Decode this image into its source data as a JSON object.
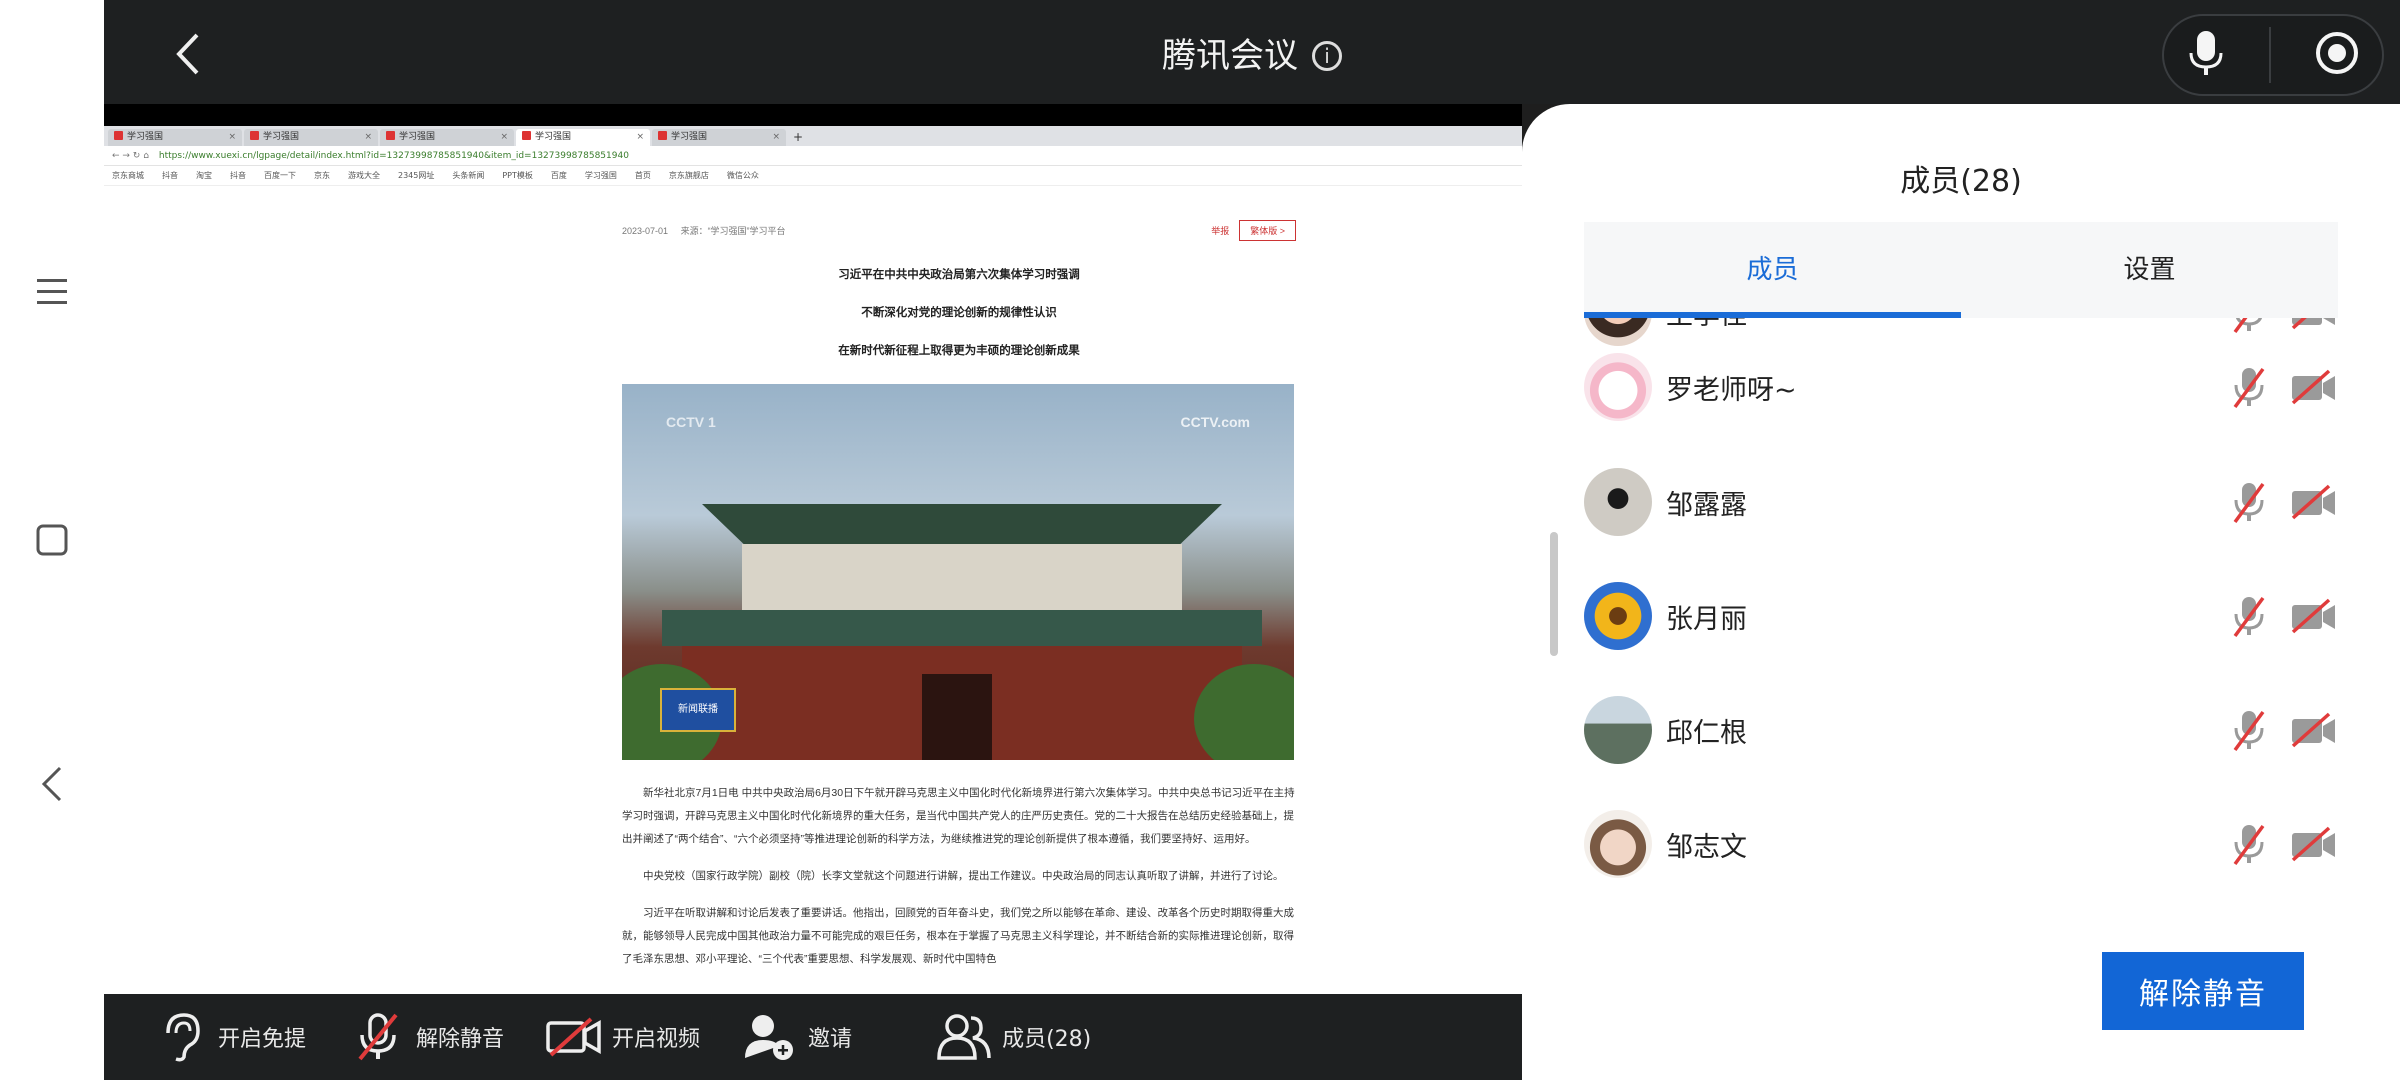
{
  "system_nav": {
    "items": [
      "menu-icon",
      "square-icon",
      "back-arrow-icon"
    ]
  },
  "header": {
    "title": "腾讯会议"
  },
  "shared_screen": {
    "browser": {
      "tabs": [
        "学习强国",
        "学习强国",
        "学习强国",
        "学习强国",
        "学习强国"
      ],
      "url": "https://www.xuexi.cn/lgpage/detail/index.html?id=13273998785851940&item_id=13273998785851940",
      "bookmarks": [
        "京东商城",
        "抖音",
        "淘宝",
        "抖音",
        "百度一下",
        "京东",
        "游戏大全",
        "2345网址",
        "头条新闻",
        "PPT模板",
        "百度",
        "学习强国",
        "首页",
        "京东旗舰店",
        "微信公众"
      ]
    },
    "article": {
      "date": "2023-07-01",
      "source": "来源：“学习强国”学习平台",
      "report_label": "举报",
      "lang_label": "繁体版 >",
      "headlines": [
        "习近平在中共中央政治局第六次集体学习时强调",
        "不断深化对党的理论创新的规律性认识",
        "在新时代新征程上取得更为丰硕的理论创新成果"
      ],
      "photo_badge": "新闻联播",
      "photo_watermark": "CCTV.com",
      "photo_watermark_left": "CCTV 1",
      "paragraphs": [
        "新华社北京7月1日电 中共中央政治局6月30日下午就开辟马克思主义中国化时代化新境界进行第六次集体学习。中共中央总书记习近平在主持学习时强调，开辟马克思主义中国化时代化新境界的重大任务，是当代中国共产党人的庄严历史责任。党的二十大报告在总结历史经验基础上，提出并阐述了“两个结合”、“六个必须坚持”等推进理论创新的科学方法，为继续推进党的理论创新提供了根本遵循，我们要坚持好、运用好。",
        "中央党校（国家行政学院）副校（院）长李文堂就这个问题进行讲解，提出工作建议。中央政治局的同志认真听取了讲解，并进行了讨论。",
        "习近平在听取讲解和讨论后发表了重要讲话。他指出，回顾党的百年奋斗史，我们党之所以能够在革命、建设、改革各个历史时期取得重大成就，能够领导人民完成中国其他政治力量不可能完成的艰巨任务，根本在于掌握了马克思主义科学理论，并不断结合新的实际推进理论创新，取得了毛泽东思想、邓小平理论、“三个代表”重要思想、科学发展观、新时代中国特色"
      ]
    }
  },
  "toolbar": {
    "items": [
      {
        "label": "开启免提",
        "icon": "ear-icon"
      },
      {
        "label": "解除静音",
        "icon": "mic-off-icon"
      },
      {
        "label": "开启视频",
        "icon": "video-off-icon"
      },
      {
        "label": "邀请",
        "icon": "add-user-icon"
      },
      {
        "label": "成员(28)",
        "icon": "members-icon"
      }
    ]
  },
  "members_panel": {
    "title": "成员(28)",
    "tabs": [
      "成员",
      "设置"
    ],
    "active_tab": "成员",
    "members": [
      {
        "name": "王李佳",
        "mic": "muted",
        "video": "off"
      },
      {
        "name": "罗老师呀~",
        "mic": "muted",
        "video": "off"
      },
      {
        "name": "邹露露",
        "mic": "muted",
        "video": "off"
      },
      {
        "name": "张月丽",
        "mic": "muted",
        "video": "off"
      },
      {
        "name": "邱仁根",
        "mic": "muted",
        "video": "off"
      },
      {
        "name": "邹志文",
        "mic": "muted",
        "video": "off"
      }
    ],
    "unmute_button": "解除静音"
  },
  "colors": {
    "accent": "#1266d6",
    "muted_red": "#e03b3b",
    "bar_bg": "#1e2021"
  }
}
